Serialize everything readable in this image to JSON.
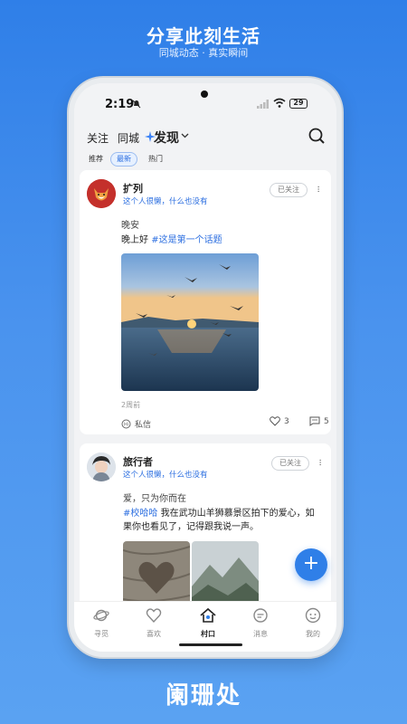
{
  "promo": {
    "title": "分享此刻生活",
    "subtitle": "同城动态 · 真实瞬间",
    "brand": "阑珊处"
  },
  "status_bar": {
    "time": "2:19",
    "battery": "29"
  },
  "top_nav": {
    "tabs": [
      {
        "label": "关注",
        "active": false
      },
      {
        "label": "同城",
        "active": false
      },
      {
        "label": "发现",
        "active": true
      }
    ]
  },
  "sub_tabs": [
    {
      "label": "推荐",
      "active": false
    },
    {
      "label": "最新",
      "active": true
    },
    {
      "label": "热门",
      "active": false
    }
  ],
  "posts": [
    {
      "author": "扩列",
      "bio": "这个人很懒，什么也没有",
      "follow_label": "已关注",
      "title": "晚安",
      "text_prefix": "晚上好 ",
      "hashtag": "#这是第一个话题",
      "time": "2周前",
      "message_label": "私信",
      "likes": "3",
      "comments": "5"
    },
    {
      "author": "旅行者",
      "bio": "这个人很懒，什么也没有",
      "follow_label": "已关注",
      "title": "爱，只为你而在",
      "hashtag": "#校哈哈",
      "text_line1_rest": " 我在武功山羊狮慕景区拍下的爱心，如",
      "text_line2": "果你也看见了，记得跟我说一声。"
    }
  ],
  "fab_label": "+",
  "bottom_nav": [
    {
      "label": "寻觅",
      "icon": "planet-icon",
      "active": false
    },
    {
      "label": "喜欢",
      "icon": "heart-icon",
      "active": false
    },
    {
      "label": "村口",
      "icon": "village-icon",
      "active": true
    },
    {
      "label": "消息",
      "icon": "message-icon",
      "active": false
    },
    {
      "label": "我的",
      "icon": "profile-icon",
      "active": false
    }
  ],
  "colors": {
    "accent": "#2f7fe8",
    "hashtag": "#2b6ee0",
    "background": "#f2f3f5"
  }
}
